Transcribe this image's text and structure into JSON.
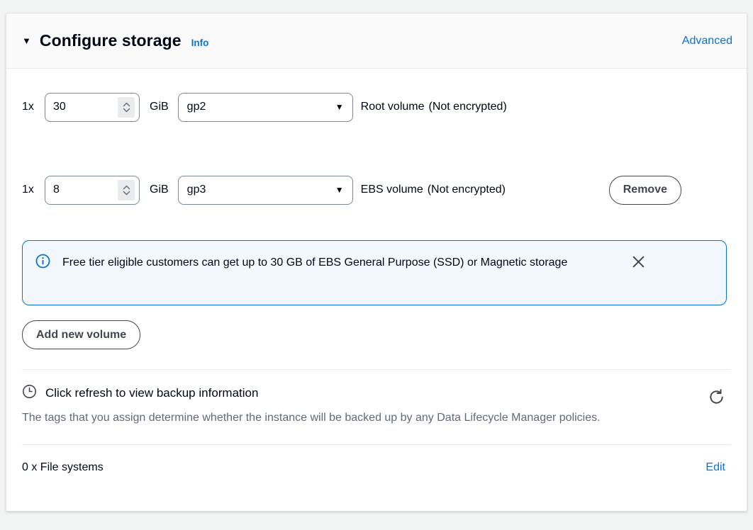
{
  "header": {
    "collapse_caret": "▼",
    "title": "Configure storage",
    "info_label": "Info",
    "advanced_label": "Advanced"
  },
  "volumes": [
    {
      "multiplier": "1x",
      "size": "30",
      "unit": "GiB",
      "type": "gp2",
      "label": "Root volume",
      "encryption": "(Not encrypted)",
      "arrow": "▼"
    },
    {
      "multiplier": "1x",
      "size": "8",
      "unit": "GiB",
      "type": "gp3",
      "label": "EBS volume",
      "encryption": "(Not encrypted)",
      "arrow": "▼",
      "remove_label": "Remove"
    }
  ],
  "alert": {
    "icon": "info-circle-icon",
    "text": "Free tier eligible customers can get up to 30 GB of EBS General Purpose (SSD) or Magnetic storage",
    "close_icon": "close-icon"
  },
  "add_volume_label": "Add new volume",
  "backup": {
    "icon": "clock-icon",
    "title": "Click refresh to view backup information",
    "description": "The tags that you assign determine whether the instance will be backed up by any Data Lifecycle Manager policies.",
    "refresh_icon": "refresh-icon"
  },
  "file_systems": {
    "label": "0 x File systems",
    "edit_label": "Edit"
  },
  "colors": {
    "link": "#0972d3",
    "alert_border": "#0972d3",
    "alert_background": "#f2f8fd",
    "button_border": "#424650",
    "text": "#000716",
    "muted_text": "#5f6b7a",
    "panel_background": "#ffffff",
    "page_background": "#f2f3f3"
  }
}
